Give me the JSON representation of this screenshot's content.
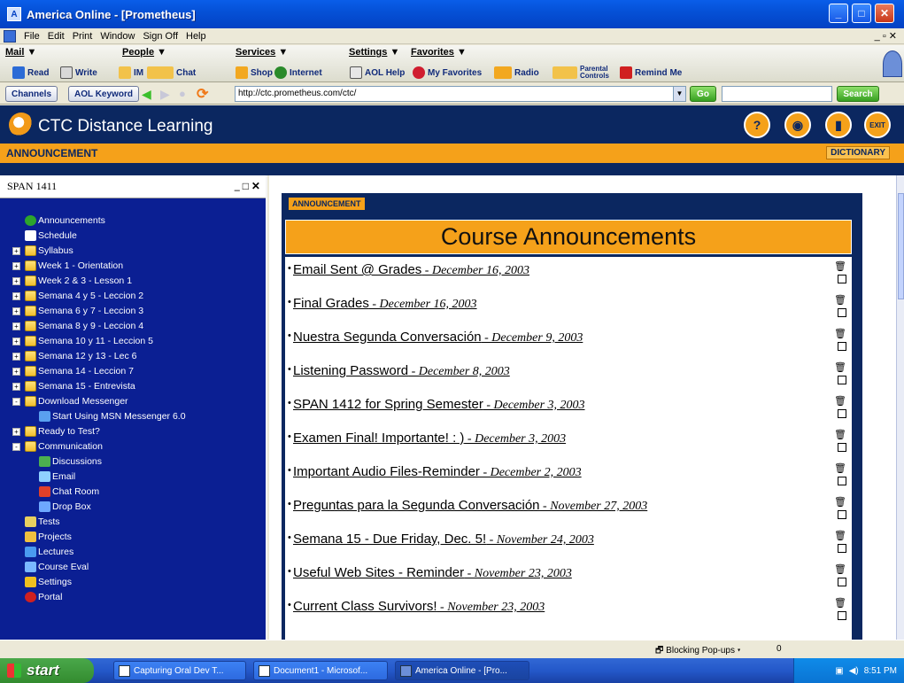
{
  "window": {
    "title": "America Online - [Prometheus]"
  },
  "menu": [
    "File",
    "Edit",
    "Print",
    "Window",
    "Sign Off",
    "Help"
  ],
  "aol": {
    "categories": [
      "Mail",
      "People",
      "Services",
      "Settings",
      "Favorites"
    ],
    "buttons": [
      "Read",
      "Write",
      "IM",
      "Chat",
      "Shop",
      "Internet",
      "AOL Help",
      "My Favorites",
      "Radio",
      "Parental Controls",
      "Remind Me"
    ]
  },
  "address": {
    "channels": "Channels",
    "keyword": "AOL Keyword",
    "url": "http://ctc.prometheus.com/ctc/",
    "go": "Go",
    "search_placeholder": "",
    "search": "Search"
  },
  "banner": {
    "brand": "CTC Distance Learning",
    "section": "ANNOUNCEMENT",
    "dictionary": "DICTIONARY"
  },
  "sidebar": {
    "course": "SPAN 1411",
    "items": [
      {
        "label": "Announcements",
        "icon": "alert-icon",
        "level": 1,
        "expander": ""
      },
      {
        "label": "Schedule",
        "icon": "calendar-icon",
        "level": 1,
        "expander": ""
      },
      {
        "label": "Syllabus",
        "icon": "folder-icon",
        "level": 0,
        "expander": "+"
      },
      {
        "label": "Week 1 - Orientation",
        "icon": "folder-icon",
        "level": 0,
        "expander": "+"
      },
      {
        "label": "Week 2 & 3 - Lesson 1",
        "icon": "folder-icon",
        "level": 0,
        "expander": "+"
      },
      {
        "label": "Semana 4 y 5 - Leccion 2",
        "icon": "folder-icon",
        "level": 0,
        "expander": "+"
      },
      {
        "label": "Semana 6 y 7 - Leccion 3",
        "icon": "folder-icon",
        "level": 0,
        "expander": "+"
      },
      {
        "label": "Semana 8 y 9 - Leccion 4",
        "icon": "folder-icon",
        "level": 0,
        "expander": "+"
      },
      {
        "label": "Semana 10 y 11 - Leccion 5",
        "icon": "folder-icon",
        "level": 0,
        "expander": "+"
      },
      {
        "label": "Semana 12 y 13 - Lec 6",
        "icon": "folder-icon",
        "level": 0,
        "expander": "+"
      },
      {
        "label": "Semana 14 - Leccion 7",
        "icon": "folder-icon",
        "level": 0,
        "expander": "+"
      },
      {
        "label": "Semana 15 - Entrevista",
        "icon": "folder-icon",
        "level": 0,
        "expander": "+"
      },
      {
        "label": "Download Messenger",
        "icon": "folder-icon",
        "level": 0,
        "expander": "-"
      },
      {
        "label": "Start Using MSN Messenger 6.0",
        "icon": "messenger-icon",
        "level": 2,
        "expander": ""
      },
      {
        "label": "Ready to Test?",
        "icon": "folder-icon",
        "level": 0,
        "expander": "+"
      },
      {
        "label": "Communication",
        "icon": "folder-icon",
        "level": 0,
        "expander": "-"
      },
      {
        "label": "Discussions",
        "icon": "discussion-icon",
        "level": 2,
        "expander": ""
      },
      {
        "label": "Email",
        "icon": "email-icon",
        "level": 2,
        "expander": ""
      },
      {
        "label": "Chat Room",
        "icon": "chat-icon",
        "level": 2,
        "expander": ""
      },
      {
        "label": "Drop Box",
        "icon": "dropbox-icon",
        "level": 2,
        "expander": ""
      },
      {
        "label": "Tests",
        "icon": "test-icon",
        "level": 1,
        "expander": ""
      },
      {
        "label": "Projects",
        "icon": "project-icon",
        "level": 1,
        "expander": ""
      },
      {
        "label": "Lectures",
        "icon": "lecture-icon",
        "level": 1,
        "expander": ""
      },
      {
        "label": "Course Eval",
        "icon": "eval-icon",
        "level": 1,
        "expander": ""
      },
      {
        "label": "Settings",
        "icon": "settings-icon",
        "level": 1,
        "expander": ""
      },
      {
        "label": "Portal",
        "icon": "portal-icon",
        "level": 1,
        "expander": ""
      }
    ]
  },
  "main": {
    "label": "ANNOUNCEMENT",
    "title": "Course Announcements",
    "announcements": [
      {
        "title": "Email Sent @ Grades",
        "date": " - December 16, 2003"
      },
      {
        "title": "Final Grades",
        "date": " - December 16, 2003"
      },
      {
        "title": "Nuestra Segunda Conversación",
        "date": " - December 9, 2003"
      },
      {
        "title": "Listening Password",
        "date": " - December 8, 2003"
      },
      {
        "title": "SPAN 1412 for Spring Semester",
        "date": " - December 3, 2003"
      },
      {
        "title": "Examen Final!  Importante!  : )",
        "date": " - December 3, 2003"
      },
      {
        "title": "Important Audio Files-Reminder",
        "date": " - December 2, 2003"
      },
      {
        "title": "Preguntas para la Segunda Conversación",
        "date": " - November 27, 2003"
      },
      {
        "title": "Semana 15 - Due Friday, Dec. 5!",
        "date": " - November 24, 2003"
      },
      {
        "title": "Useful Web Sites - Reminder",
        "date": " - November 23, 2003"
      },
      {
        "title": "Current Class Survivors!",
        "date": " - November 23, 2003"
      }
    ]
  },
  "status": {
    "popup": "Blocking Pop-ups",
    "count": "0"
  },
  "taskbar": {
    "start": "start",
    "tasks": [
      "Capturing Oral Dev T...",
      "Document1 - Microsof...",
      "America Online - [Pro..."
    ],
    "time": "8:51 PM"
  },
  "colors": {
    "navy": "#0b2760",
    "orange": "#f5a11a",
    "tree_bg": "#0b1f93"
  }
}
